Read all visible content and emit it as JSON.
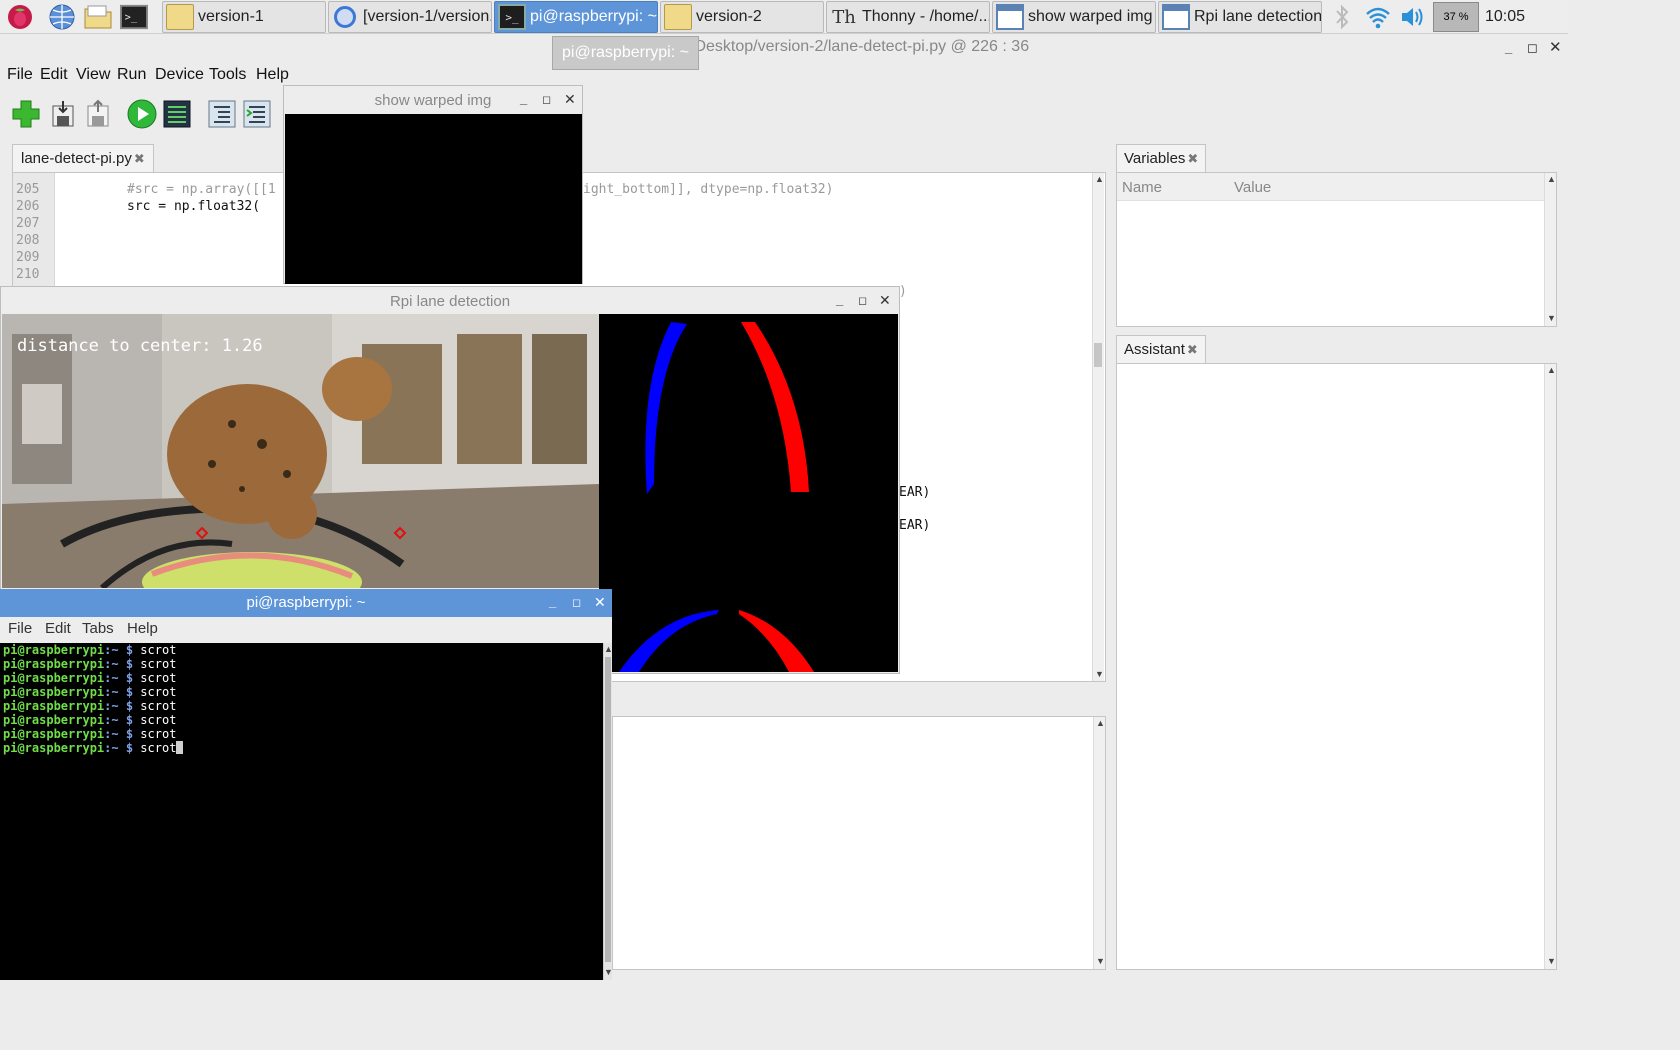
{
  "taskbar": {
    "tasks": [
      {
        "label": "version-1",
        "icon": "folder-icon"
      },
      {
        "label": "[version-1/version...",
        "icon": "chromium-icon"
      },
      {
        "label": "pi@raspberrypi: ~",
        "icon": "terminal-icon",
        "active": true
      },
      {
        "label": "version-2",
        "icon": "folder-icon"
      },
      {
        "label": "Thonny  -  /home/...",
        "icon": "thonny-icon"
      },
      {
        "label": "show warped img",
        "icon": "window-icon"
      },
      {
        "label": "Rpi lane detection",
        "icon": "window-icon"
      }
    ],
    "tooltip": "pi@raspberrypi: ~",
    "cpu_usage": "37 %",
    "clock": "10:05"
  },
  "thonny": {
    "title": "/Desktop/version-2/lane-detect-pi.py  @  226 : 36",
    "menu": [
      "File",
      "Edit",
      "View",
      "Run",
      "Device",
      "Tools",
      "Help"
    ],
    "editor_tab": "lane-detect-pi.py",
    "line_numbers": [
      "205",
      "206",
      "207",
      "208",
      "209",
      "210"
    ],
    "code": {
      "l205_start": "#src = np.array([[1",
      "l205_end": "ight_bottom]], dtype=np.float32)",
      "l206": "src = np.float32(",
      "l211_end": ")",
      "frag1": "EAR)",
      "frag2": "EAR)"
    },
    "variables_tab": "Variables",
    "variables_headers": {
      "name": "Name",
      "value": "Value"
    },
    "assistant_tab": "Assistant"
  },
  "warped_window": {
    "title": "show warped img"
  },
  "lane_window": {
    "title": "Rpi lane detection",
    "overlay_text": "distance to center: 1.26"
  },
  "terminal": {
    "title": "pi@raspberrypi: ~",
    "menu": [
      "File",
      "Edit",
      "Tabs",
      "Help"
    ],
    "prompt_user": "pi@raspberrypi",
    "prompt_path": ":~ ",
    "prompt_symbol": "$ ",
    "lines": [
      "scrot",
      "scrot",
      "scrot",
      "scrot",
      "scrot",
      "scrot",
      "scrot",
      "scrot"
    ]
  },
  "colors": {
    "accent": "#5e95d8",
    "left_lane": "#0000ff",
    "right_lane": "#ff0000",
    "prompt_green": "#6fde4a"
  }
}
